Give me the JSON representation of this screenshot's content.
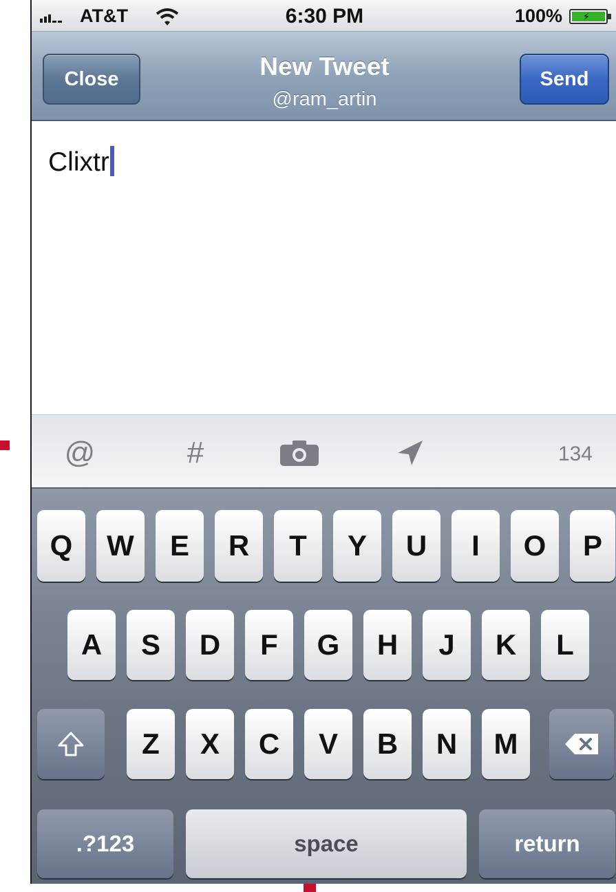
{
  "status_bar": {
    "carrier": "AT&T",
    "time": "6:30 PM",
    "battery_percent": "100%",
    "battery_level": 1.0,
    "signal_icon": "signal-bars-icon",
    "wifi_icon": "wifi-icon",
    "battery_icon": "battery-charging-icon"
  },
  "nav_bar": {
    "close_label": "Close",
    "title": "New Tweet",
    "subtitle": "@ram_artin",
    "send_label": "Send"
  },
  "compose": {
    "text": "Clixtr"
  },
  "toolbar": {
    "mention_label": "@",
    "hashtag_label": "#",
    "camera_icon": "camera-icon",
    "location_icon": "location-arrow-icon",
    "char_count": "134"
  },
  "keyboard": {
    "row1": [
      "Q",
      "W",
      "E",
      "R",
      "T",
      "Y",
      "U",
      "I",
      "O",
      "P"
    ],
    "row2": [
      "A",
      "S",
      "D",
      "F",
      "G",
      "H",
      "J",
      "K",
      "L"
    ],
    "row3": [
      "Z",
      "X",
      "C",
      "V",
      "B",
      "N",
      "M"
    ],
    "shift_icon": "shift-arrow-icon",
    "delete_icon": "backspace-icon",
    "numbers_label": ".?123",
    "space_label": "space",
    "return_label": "return"
  },
  "colors": {
    "send_button": "#3a68c3",
    "nav_bar": "#8ea2b8",
    "cursor": "#4c5bb5",
    "marker": "#c8102e"
  }
}
